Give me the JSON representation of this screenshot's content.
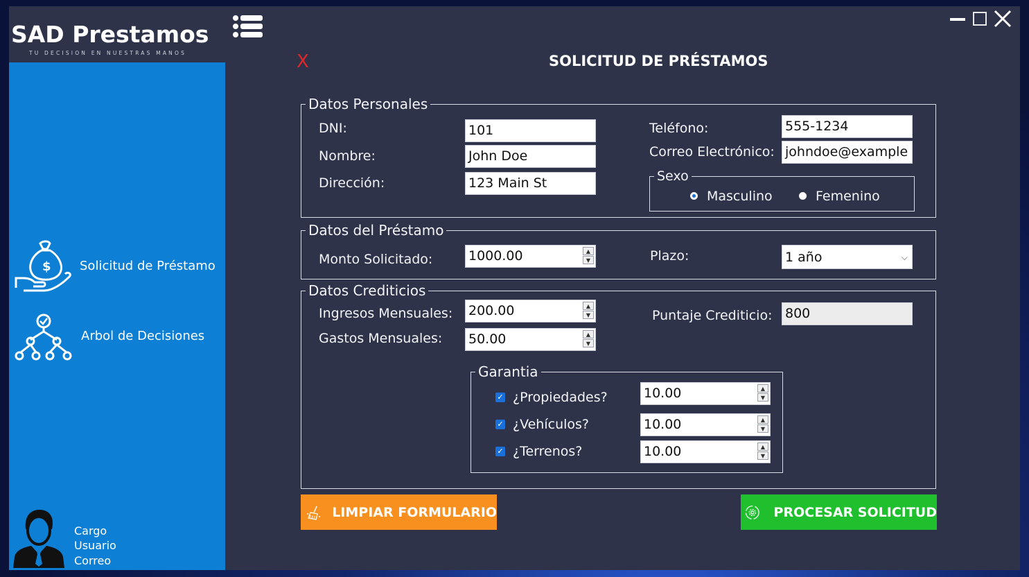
{
  "brand": {
    "title": "SAD Prestamos",
    "tagline": "TU DECISION EN NUESTRAS MANOS"
  },
  "sidebar": {
    "items": [
      {
        "label": "Solicitud de Préstamo",
        "icon": "money-hand-icon"
      },
      {
        "label": "Arbol de Decisiones",
        "icon": "decision-tree-icon"
      }
    ],
    "user": {
      "cargo": "Cargo",
      "usuario": "Usuario",
      "correo": "Correo"
    }
  },
  "window": {
    "close_x": "X",
    "title": "SOLICITUD DE PRÉSTAMOS"
  },
  "personal": {
    "legend": "Datos Personales",
    "dni_label": "DNI:",
    "dni": "101",
    "nombre_label": "Nombre:",
    "nombre": "John Doe",
    "direccion_label": "Dirección:",
    "direccion": "123 Main St",
    "telefono_label": "Teléfono:",
    "telefono": "555-1234",
    "correo_label": "Correo Electrónico:",
    "correo": "johndoe@example",
    "sexo": {
      "legend": "Sexo",
      "masculino": "Masculino",
      "femenino": "Femenino",
      "selected": "Masculino"
    }
  },
  "loan": {
    "legend": "Datos del Préstamo",
    "monto_label": "Monto Solicitado:",
    "monto": "1000.00",
    "plazo_label": "Plazo:",
    "plazo": "1 año"
  },
  "credit": {
    "legend": "Datos Crediticios",
    "ingresos_label": "Ingresos Mensuales:",
    "ingresos": "200.00",
    "gastos_label": "Gastos Mensuales:",
    "gastos": "50.00",
    "puntaje_label": "Puntaje Crediticio:",
    "puntaje": "800",
    "garantia": {
      "legend": "Garantia",
      "items": [
        {
          "label": "¿Propiedades?",
          "value": "10.00",
          "checked": true
        },
        {
          "label": "¿Vehículos?",
          "value": "10.00",
          "checked": true
        },
        {
          "label": "¿Terrenos?",
          "value": "10.00",
          "checked": true
        }
      ]
    }
  },
  "buttons": {
    "clear": "LIMPIAR FORMULARIO",
    "process": "PROCESAR SOLICITUD"
  },
  "colors": {
    "sidebar": "#0d7fd4",
    "panel": "#2e3349",
    "clear_btn": "#f7901e",
    "process_btn": "#1fbf2e",
    "close_x": "#e0262b"
  }
}
